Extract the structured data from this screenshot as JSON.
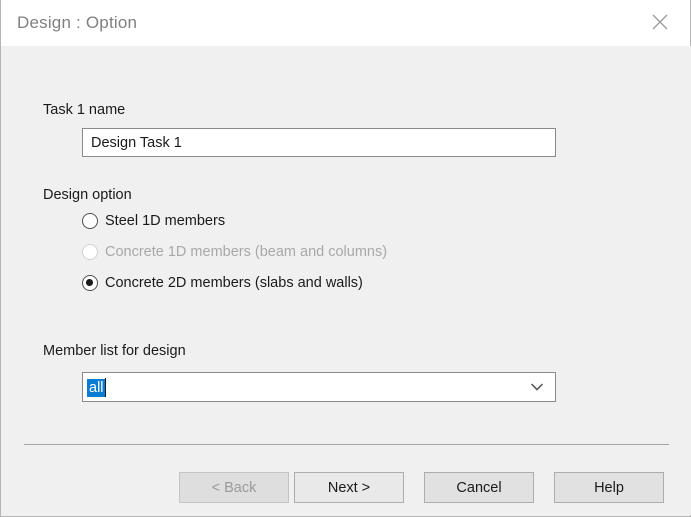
{
  "window": {
    "title": "Design : Option",
    "close_icon": "close-icon"
  },
  "form": {
    "task_name": {
      "label": "Task 1 name",
      "value": "Design Task 1",
      "placeholder": ""
    },
    "design_option": {
      "label": "Design option",
      "options": [
        {
          "label": "Steel 1D members",
          "selected": false,
          "disabled": false
        },
        {
          "label": "Concrete 1D members (beam and columns)",
          "selected": false,
          "disabled": true
        },
        {
          "label": "Concrete 2D members (slabs and walls)",
          "selected": true,
          "disabled": false
        }
      ]
    },
    "member_list": {
      "label": "Member list for design",
      "value": "all",
      "dropdown_icon": "chevron-down-icon"
    }
  },
  "footer": {
    "buttons": [
      {
        "label": "< Back",
        "disabled": true
      },
      {
        "label": "Next >",
        "disabled": false
      },
      {
        "label": "Cancel",
        "disabled": false
      },
      {
        "label": "Help",
        "disabled": false
      }
    ]
  },
  "colors": {
    "selection_blue": "#0a7cd4",
    "dialog_background": "#f0f0f0",
    "titlebar_background": "#ffffff",
    "title_text": "#808080"
  }
}
